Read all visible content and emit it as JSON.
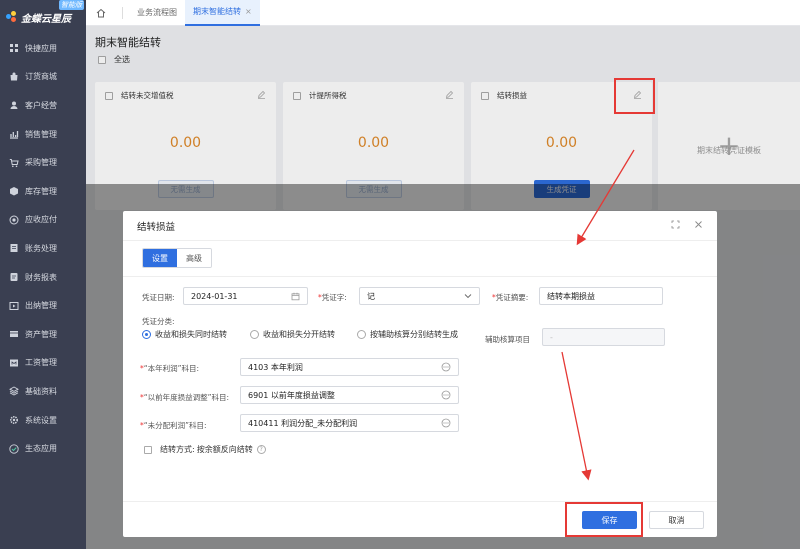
{
  "app": {
    "logo_text": "金蝶云星辰",
    "logo_badge": "智能版"
  },
  "sidebar": {
    "items": [
      {
        "label": "快捷应用",
        "icon": "grid-icon"
      },
      {
        "label": "订货商城",
        "icon": "shop-icon"
      },
      {
        "label": "客户经营",
        "icon": "user-icon"
      },
      {
        "label": "销售管理",
        "icon": "chart-icon"
      },
      {
        "label": "采购管理",
        "icon": "cart-icon"
      },
      {
        "label": "库存管理",
        "icon": "box-icon"
      },
      {
        "label": "应收应付",
        "icon": "coin-icon"
      },
      {
        "label": "账务处理",
        "icon": "ledger-icon"
      },
      {
        "label": "财务报表",
        "icon": "report-icon"
      },
      {
        "label": "出纳管理",
        "icon": "cashier-icon"
      },
      {
        "label": "资产管理",
        "icon": "asset-icon"
      },
      {
        "label": "工资管理",
        "icon": "salary-icon"
      },
      {
        "label": "基础资料",
        "icon": "layers-icon"
      },
      {
        "label": "系统设置",
        "icon": "gear-icon"
      },
      {
        "label": "生态应用",
        "icon": "check-icon"
      }
    ]
  },
  "tabs": {
    "home_icon": "home-icon",
    "items": [
      {
        "label": "业务流程图",
        "active": false
      },
      {
        "label": "期末智能结转",
        "active": true
      }
    ],
    "close_glyph": "×"
  },
  "page": {
    "title": "期末智能结转",
    "select_all": "全选",
    "cards": [
      {
        "title": "结转未交增值税",
        "amount": "0.00",
        "button": "无需生成",
        "button_state": "disabled"
      },
      {
        "title": "计提所得税",
        "amount": "0.00",
        "button": "无需生成",
        "button_state": "disabled"
      },
      {
        "title": "结转损益",
        "amount": "0.00",
        "button": "生成凭证",
        "button_state": "primary"
      }
    ],
    "add_card": {
      "plus": "+",
      "label": "期末结转凭证模板"
    }
  },
  "modal": {
    "title": "结转损益",
    "tabs": [
      {
        "label": "设置",
        "active": true
      },
      {
        "label": "高级",
        "active": false
      }
    ],
    "voucher_date_label": "凭证日期:",
    "voucher_date_value": "2024-01-31",
    "voucher_word_label": "凭证字:",
    "voucher_word_value": "记",
    "summary_label": "凭证摘要:",
    "summary_value": "结转本期损益",
    "category_label": "凭证分类:",
    "radios": [
      {
        "label": "收益和损失同时结转",
        "checked": true
      },
      {
        "label": "收益和损失分开结转",
        "checked": false
      },
      {
        "label": "按辅助核算分别结转生成",
        "checked": false
      }
    ],
    "aux_label": "辅助核算项目",
    "aux_value": "-",
    "profit_label": "“本年利润”科目:",
    "profit_value": "4103 本年利润",
    "adjust_label": "“以前年度损益调整”科目:",
    "adjust_value": "6901 以前年度损益调整",
    "undistributed_label": "“未分配利润”科目:",
    "undistributed_value": "410411 利润分配_未分配利润",
    "method_label": "结转方式:",
    "method_value": "按余额反向结转",
    "help_glyph": "?",
    "save": "保存",
    "cancel": "取消"
  },
  "colors": {
    "primary": "#2f6fe0",
    "sidebar_bg": "#3a3f51",
    "amount": "#e08a2a",
    "annotation": "#e53935"
  }
}
